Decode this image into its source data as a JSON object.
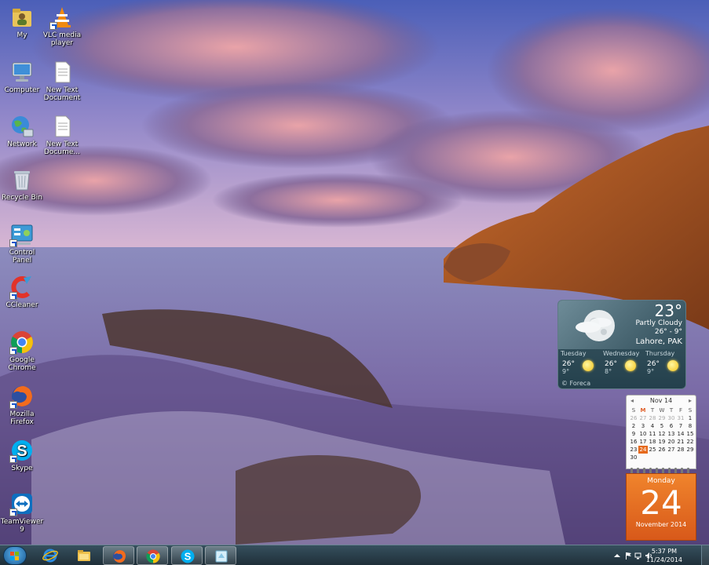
{
  "desktop_icons": [
    {
      "label": "My",
      "icon": "user-folder-icon"
    },
    {
      "label": "VLC media player",
      "icon": "vlc-cone-icon"
    },
    {
      "label": "Computer",
      "icon": "computer-icon"
    },
    {
      "label": "New Text Document",
      "icon": "text-document-icon"
    },
    {
      "label": "Network",
      "icon": "network-globe-icon"
    },
    {
      "label": "New Text Docume...",
      "icon": "text-document-icon"
    },
    {
      "label": "Recycle Bin",
      "icon": "recycle-bin-icon"
    },
    {
      "label": "Control Panel",
      "icon": "control-panel-icon"
    },
    {
      "label": "CCleaner",
      "icon": "ccleaner-icon"
    },
    {
      "label": "Google Chrome",
      "icon": "chrome-icon"
    },
    {
      "label": "Mozilla Firefox",
      "icon": "firefox-icon"
    },
    {
      "label": "Skype",
      "icon": "skype-icon"
    },
    {
      "label": "TeamViewer 9",
      "icon": "teamviewer-icon"
    }
  ],
  "weather": {
    "temperature": "23°",
    "condition": "Partly Cloudy",
    "range": "26° - 9°",
    "location": "Lahore, PAK",
    "forecast": [
      {
        "day": "Tuesday",
        "high": "26°",
        "low": "9°"
      },
      {
        "day": "Wednesday",
        "high": "26°",
        "low": "8°"
      },
      {
        "day": "Thursday",
        "high": "26°",
        "low": "9°"
      }
    ],
    "provider": "© Foreca"
  },
  "calendar": {
    "month_label": "Nov 14",
    "weekday_headers": [
      "S",
      "M",
      "T",
      "W",
      "T",
      "F",
      "S"
    ],
    "weeks": [
      [
        "26",
        "27",
        "28",
        "29",
        "30",
        "31",
        "1"
      ],
      [
        "2",
        "3",
        "4",
        "5",
        "6",
        "7",
        "8"
      ],
      [
        "9",
        "10",
        "11",
        "12",
        "13",
        "14",
        "15"
      ],
      [
        "16",
        "17",
        "18",
        "19",
        "20",
        "21",
        "22"
      ],
      [
        "23",
        "24",
        "25",
        "26",
        "27",
        "28",
        "29"
      ],
      [
        "30",
        "",
        "",
        "",
        "",
        "",
        ""
      ]
    ],
    "weekday_name": "Monday",
    "day_number": "24",
    "month_year": "November 2014",
    "today_color": "#e66a1d"
  },
  "taskbar": {
    "pinned": [
      {
        "name": "internet-explorer",
        "icon": "internet-explorer-icon"
      },
      {
        "name": "windows-explorer",
        "icon": "folder-icon"
      },
      {
        "name": "firefox",
        "icon": "firefox-icon"
      },
      {
        "name": "chrome",
        "icon": "chrome-icon"
      },
      {
        "name": "skype",
        "icon": "skype-icon"
      },
      {
        "name": "unknown-app",
        "icon": "window-icon"
      }
    ],
    "clock_time": "5:37 PM",
    "clock_date": "11/24/2014"
  }
}
